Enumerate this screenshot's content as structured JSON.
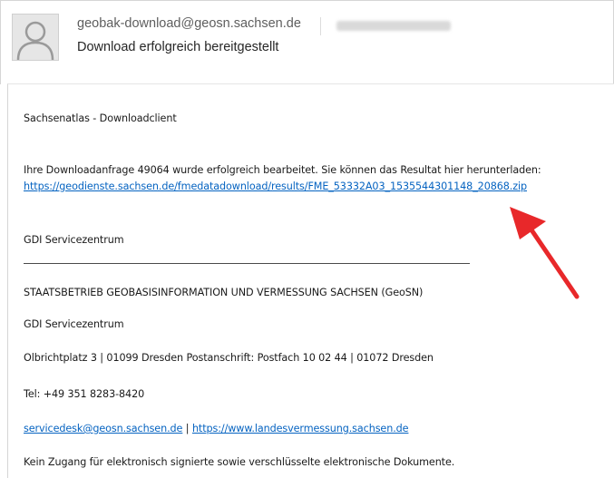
{
  "header": {
    "sender": "geobak-download@geosn.sachsen.de",
    "subject": "Download erfolgreich bereitgestellt"
  },
  "body": {
    "heading": "Sachsenatlas - Downloadclient",
    "message": "Ihre Downloadanfrage 49064 wurde erfolgreich bearbeitet. Sie können das Resultat hier herunterladen:",
    "download_link": "https://geodienste.sachsen.de/fmedatadownload/results/FME_53332A03_1535544301148_20868.zip",
    "signature_name": "GDI Servicezentrum",
    "organization": "STAATSBETRIEB GEOBASISINFORMATION UND VERMESSUNG SACHSEN (GeoSN)",
    "department": "GDI Servicezentrum",
    "address": "Olbrichtplatz 3 | 01099 Dresden Postanschrift: Postfach 10 02 44 | 01072 Dresden",
    "phone": "Tel: +49 351 8283-8420",
    "email_link": "servicedesk@geosn.sachsen.de",
    "contact_separator": "|",
    "website_link": "https://www.landesvermessung.sachsen.de",
    "notice": "Kein Zugang für elektronisch signierte sowie verschlüsselte elektronische Dokumente."
  },
  "colors": {
    "link": "#0563c1",
    "annotation_arrow": "#e8282a"
  },
  "icons": {
    "avatar": "person-silhouette-icon"
  }
}
